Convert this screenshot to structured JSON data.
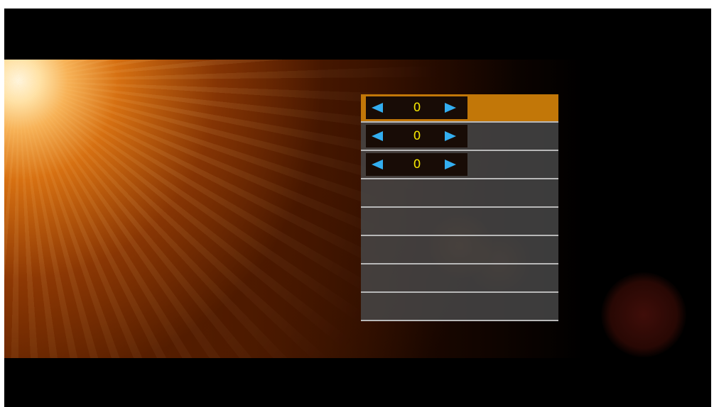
{
  "menu": {
    "rows": [
      {
        "value": "0",
        "selected": true
      },
      {
        "value": "0",
        "selected": false
      },
      {
        "value": "0",
        "selected": false
      },
      {},
      {},
      {},
      {},
      {}
    ]
  },
  "colors": {
    "selected_row": "#c27708",
    "row_background": "#464646",
    "arrow": "#33aef0",
    "value_text": "#f3e400"
  },
  "icons": [
    "arrow-left-icon",
    "arrow-right-icon"
  ]
}
